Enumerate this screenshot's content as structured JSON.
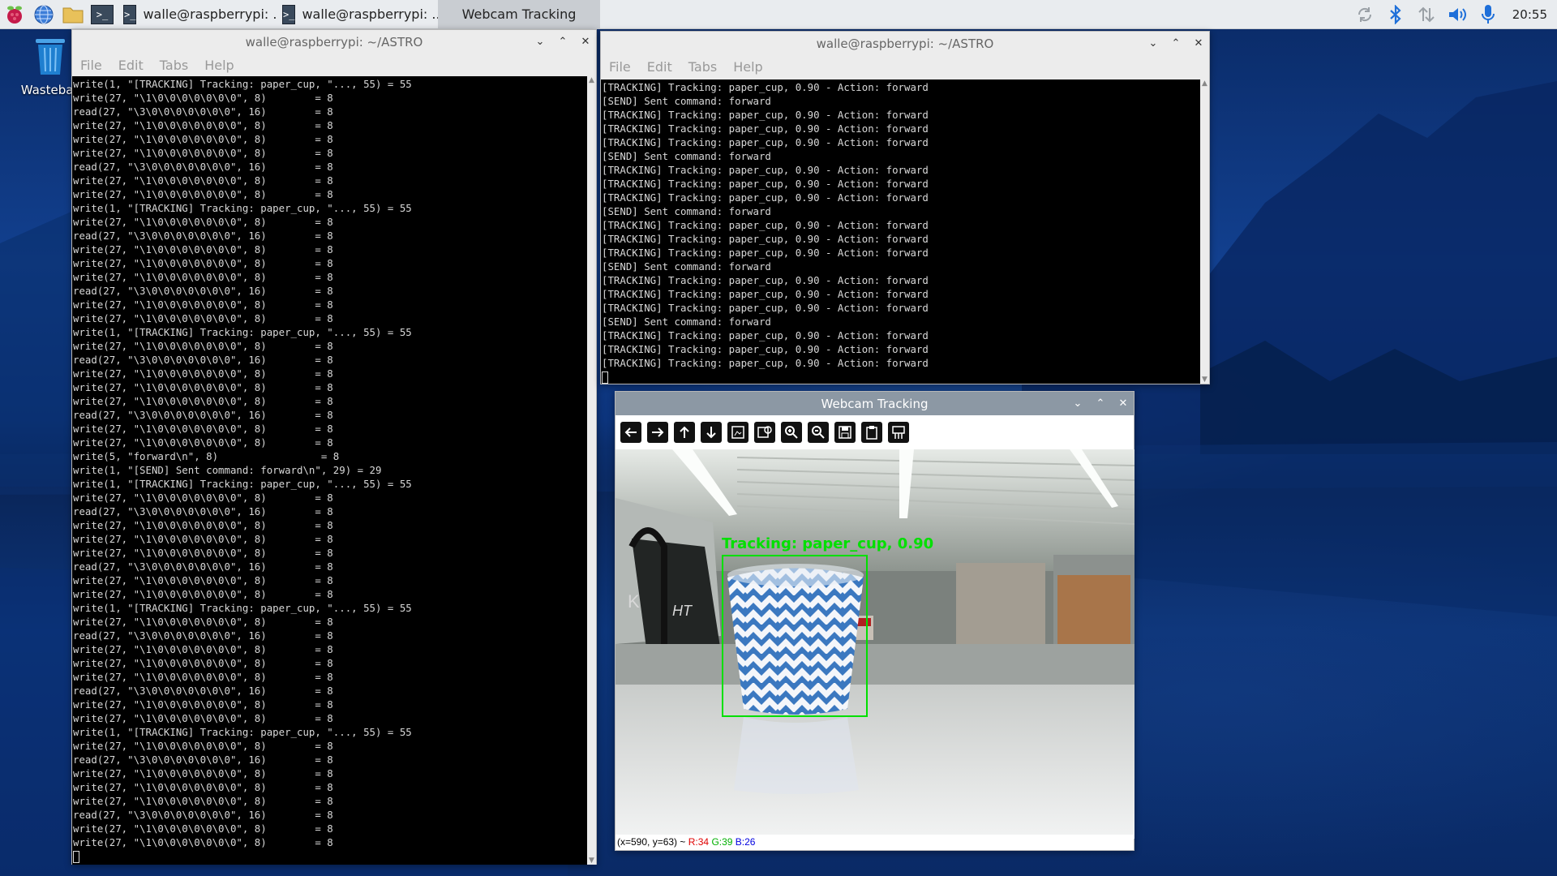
{
  "taskbar": {
    "tasks": [
      {
        "label": "walle@raspberrypi: ..."
      },
      {
        "label": "walle@raspberrypi: ..."
      },
      {
        "label": "Webcam Tracking"
      }
    ],
    "clock": "20:55",
    "tray_icons": [
      "sync-icon",
      "bluetooth-icon",
      "network-icon",
      "volume-icon",
      "microphone-icon"
    ]
  },
  "desktop": {
    "wastebasket_label": "Wastebas"
  },
  "term_left": {
    "title": "walle@raspberrypi: ~/ASTRO",
    "menu": [
      "File",
      "Edit",
      "Tabs",
      "Help"
    ],
    "lines": [
      "write(1, \"[TRACKING] Tracking: paper_cup, \"..., 55) = 55",
      "write(27, \"\\1\\0\\0\\0\\0\\0\\0\\0\", 8)        = 8",
      "read(27, \"\\3\\0\\0\\0\\0\\0\\0\\0\", 16)        = 8",
      "write(27, \"\\1\\0\\0\\0\\0\\0\\0\\0\", 8)        = 8",
      "write(27, \"\\1\\0\\0\\0\\0\\0\\0\\0\", 8)        = 8",
      "write(27, \"\\1\\0\\0\\0\\0\\0\\0\\0\", 8)        = 8",
      "read(27, \"\\3\\0\\0\\0\\0\\0\\0\\0\", 16)        = 8",
      "write(27, \"\\1\\0\\0\\0\\0\\0\\0\\0\", 8)        = 8",
      "write(27, \"\\1\\0\\0\\0\\0\\0\\0\\0\", 8)        = 8",
      "write(1, \"[TRACKING] Tracking: paper_cup, \"..., 55) = 55",
      "write(27, \"\\1\\0\\0\\0\\0\\0\\0\\0\", 8)        = 8",
      "read(27, \"\\3\\0\\0\\0\\0\\0\\0\\0\", 16)        = 8",
      "write(27, \"\\1\\0\\0\\0\\0\\0\\0\\0\", 8)        = 8",
      "write(27, \"\\1\\0\\0\\0\\0\\0\\0\\0\", 8)        = 8",
      "write(27, \"\\1\\0\\0\\0\\0\\0\\0\\0\", 8)        = 8",
      "read(27, \"\\3\\0\\0\\0\\0\\0\\0\\0\", 16)        = 8",
      "write(27, \"\\1\\0\\0\\0\\0\\0\\0\\0\", 8)        = 8",
      "write(27, \"\\1\\0\\0\\0\\0\\0\\0\\0\", 8)        = 8",
      "write(1, \"[TRACKING] Tracking: paper_cup, \"..., 55) = 55",
      "write(27, \"\\1\\0\\0\\0\\0\\0\\0\\0\", 8)        = 8",
      "read(27, \"\\3\\0\\0\\0\\0\\0\\0\\0\", 16)        = 8",
      "write(27, \"\\1\\0\\0\\0\\0\\0\\0\\0\", 8)        = 8",
      "write(27, \"\\1\\0\\0\\0\\0\\0\\0\\0\", 8)        = 8",
      "write(27, \"\\1\\0\\0\\0\\0\\0\\0\\0\", 8)        = 8",
      "read(27, \"\\3\\0\\0\\0\\0\\0\\0\\0\", 16)        = 8",
      "write(27, \"\\1\\0\\0\\0\\0\\0\\0\\0\", 8)        = 8",
      "write(27, \"\\1\\0\\0\\0\\0\\0\\0\\0\", 8)        = 8",
      "write(5, \"forward\\n\", 8)                 = 8",
      "write(1, \"[SEND] Sent command: forward\\n\", 29) = 29",
      "write(1, \"[TRACKING] Tracking: paper_cup, \"..., 55) = 55",
      "write(27, \"\\1\\0\\0\\0\\0\\0\\0\\0\", 8)        = 8",
      "read(27, \"\\3\\0\\0\\0\\0\\0\\0\\0\", 16)        = 8",
      "write(27, \"\\1\\0\\0\\0\\0\\0\\0\\0\", 8)        = 8",
      "write(27, \"\\1\\0\\0\\0\\0\\0\\0\\0\", 8)        = 8",
      "write(27, \"\\1\\0\\0\\0\\0\\0\\0\\0\", 8)        = 8",
      "read(27, \"\\3\\0\\0\\0\\0\\0\\0\\0\", 16)        = 8",
      "write(27, \"\\1\\0\\0\\0\\0\\0\\0\\0\", 8)        = 8",
      "write(27, \"\\1\\0\\0\\0\\0\\0\\0\\0\", 8)        = 8",
      "write(1, \"[TRACKING] Tracking: paper_cup, \"..., 55) = 55",
      "write(27, \"\\1\\0\\0\\0\\0\\0\\0\\0\", 8)        = 8",
      "read(27, \"\\3\\0\\0\\0\\0\\0\\0\\0\", 16)        = 8",
      "write(27, \"\\1\\0\\0\\0\\0\\0\\0\\0\", 8)        = 8",
      "write(27, \"\\1\\0\\0\\0\\0\\0\\0\\0\", 8)        = 8",
      "write(27, \"\\1\\0\\0\\0\\0\\0\\0\\0\", 8)        = 8",
      "read(27, \"\\3\\0\\0\\0\\0\\0\\0\\0\", 16)        = 8",
      "write(27, \"\\1\\0\\0\\0\\0\\0\\0\\0\", 8)        = 8",
      "write(27, \"\\1\\0\\0\\0\\0\\0\\0\\0\", 8)        = 8",
      "write(1, \"[TRACKING] Tracking: paper_cup, \"..., 55) = 55",
      "write(27, \"\\1\\0\\0\\0\\0\\0\\0\\0\", 8)        = 8",
      "read(27, \"\\3\\0\\0\\0\\0\\0\\0\\0\", 16)        = 8",
      "write(27, \"\\1\\0\\0\\0\\0\\0\\0\\0\", 8)        = 8",
      "write(27, \"\\1\\0\\0\\0\\0\\0\\0\\0\", 8)        = 8",
      "write(27, \"\\1\\0\\0\\0\\0\\0\\0\\0\", 8)        = 8",
      "read(27, \"\\3\\0\\0\\0\\0\\0\\0\\0\", 16)        = 8",
      "write(27, \"\\1\\0\\0\\0\\0\\0\\0\\0\", 8)        = 8",
      "write(27, \"\\1\\0\\0\\0\\0\\0\\0\\0\", 8)        = 8"
    ]
  },
  "term_right": {
    "title": "walle@raspberrypi: ~/ASTRO",
    "menu": [
      "File",
      "Edit",
      "Tabs",
      "Help"
    ],
    "lines": [
      "[TRACKING] Tracking: paper_cup, 0.90 - Action: forward",
      "[SEND] Sent command: forward",
      "[TRACKING] Tracking: paper_cup, 0.90 - Action: forward",
      "[TRACKING] Tracking: paper_cup, 0.90 - Action: forward",
      "[TRACKING] Tracking: paper_cup, 0.90 - Action: forward",
      "[SEND] Sent command: forward",
      "[TRACKING] Tracking: paper_cup, 0.90 - Action: forward",
      "[TRACKING] Tracking: paper_cup, 0.90 - Action: forward",
      "[TRACKING] Tracking: paper_cup, 0.90 - Action: forward",
      "[SEND] Sent command: forward",
      "[TRACKING] Tracking: paper_cup, 0.90 - Action: forward",
      "[TRACKING] Tracking: paper_cup, 0.90 - Action: forward",
      "[TRACKING] Tracking: paper_cup, 0.90 - Action: forward",
      "[SEND] Sent command: forward",
      "[TRACKING] Tracking: paper_cup, 0.90 - Action: forward",
      "[TRACKING] Tracking: paper_cup, 0.90 - Action: forward",
      "[TRACKING] Tracking: paper_cup, 0.90 - Action: forward",
      "[SEND] Sent command: forward",
      "[TRACKING] Tracking: paper_cup, 0.90 - Action: forward",
      "[TRACKING] Tracking: paper_cup, 0.90 - Action: forward",
      "[TRACKING] Tracking: paper_cup, 0.90 - Action: forward"
    ]
  },
  "webcam": {
    "title": "Webcam Tracking",
    "tools": [
      "pan-left-icon",
      "pan-right-icon",
      "pan-up-icon",
      "pan-down-icon",
      "zoom-fit-icon",
      "zoom-original-icon",
      "zoom-in-icon",
      "zoom-out-icon",
      "save-icon",
      "copy-icon",
      "properties-icon"
    ],
    "detection_label": "Tracking: paper_cup, 0.90",
    "detection_color": "#00e000",
    "status": {
      "coords": "(x=590, y=63) ~",
      "r": "R:34",
      "g": "G:39",
      "b": "B:26"
    }
  }
}
